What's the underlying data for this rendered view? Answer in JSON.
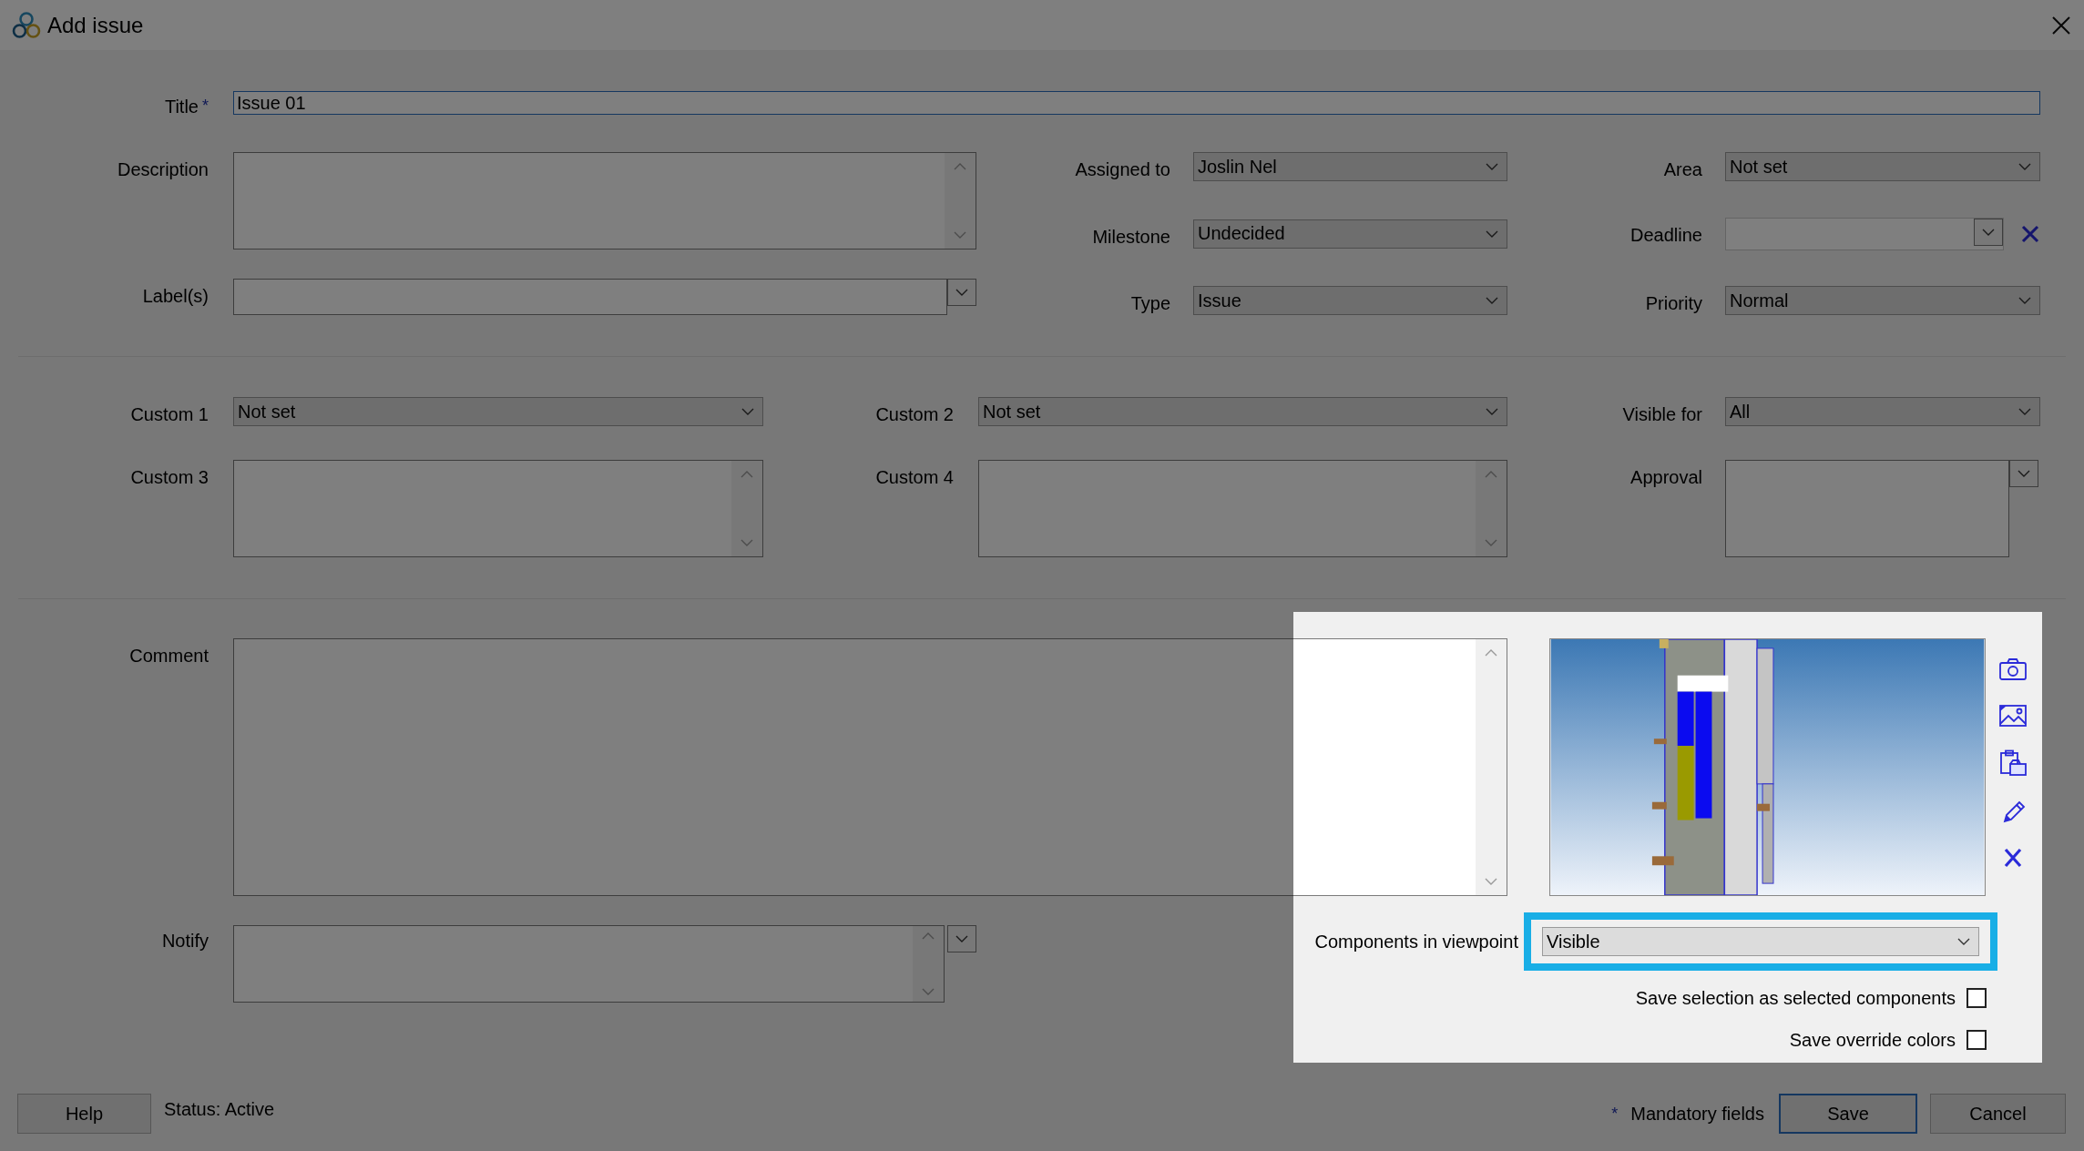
{
  "window": {
    "title": "Add issue"
  },
  "dimmed": true,
  "title_field": {
    "label": "Title",
    "mark": "*",
    "value": "Issue 01",
    "focused": true
  },
  "sections": [
    {
      "columns": [
        {
          "fields": [
            {
              "kind": "textarea",
              "label": "Description"
            },
            {
              "kind": "line_picker",
              "label": "Label(s)"
            }
          ]
        },
        {
          "fields": [
            {
              "kind": "combo",
              "label": "Assigned to",
              "value": "Joslin Nel"
            },
            {
              "kind": "combo",
              "label": "Milestone",
              "value": "Undecided"
            },
            {
              "kind": "combo",
              "label": "Type",
              "value": "Issue"
            }
          ]
        },
        {
          "fields": [
            {
              "kind": "combo",
              "label": "Area",
              "value": "Not set"
            },
            {
              "kind": "date",
              "label": "Deadline"
            },
            {
              "kind": "combo",
              "label": "Priority",
              "value": "Normal"
            }
          ]
        }
      ]
    },
    {
      "columns": [
        {
          "fields": [
            {
              "kind": "combo",
              "label": "Custom 1",
              "value": "Not set"
            },
            {
              "kind": "textarea",
              "label": "Custom 3"
            }
          ]
        },
        {
          "fields": [
            {
              "kind": "combo",
              "label": "Custom 2",
              "value": "Not set"
            },
            {
              "kind": "textarea",
              "label": "Custom 4"
            }
          ]
        },
        {
          "fields": [
            {
              "kind": "combo",
              "label": "Visible for",
              "value": "All"
            },
            {
              "kind": "list_picker",
              "label": "Approval"
            }
          ]
        }
      ]
    }
  ],
  "comment": {
    "label": "Comment"
  },
  "notify": {
    "label": "Notify"
  },
  "viewpoint": {
    "components": {
      "label": "Components in viewpoint",
      "value": "Visible",
      "highlighted": true
    },
    "options": [
      {
        "label": "Save selection as selected components",
        "checked": false
      },
      {
        "label": "Save override colors",
        "checked": false
      }
    ]
  },
  "footer": {
    "help": "Help",
    "status": "Status: Active",
    "mandatory_mark": "*",
    "mandatory_text": "Mandatory fields",
    "save": {
      "label": "Save",
      "default": true
    },
    "cancel": {
      "label": "Cancel",
      "default": false
    }
  }
}
